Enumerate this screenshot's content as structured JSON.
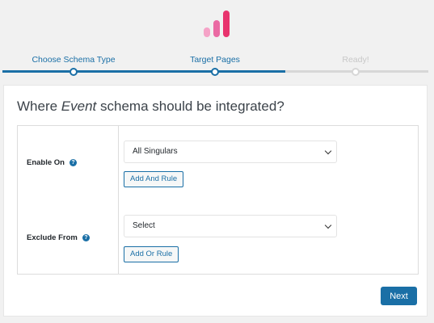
{
  "steps": [
    {
      "label": "Choose Schema Type",
      "state": "complete"
    },
    {
      "label": "Target Pages",
      "state": "current"
    },
    {
      "label": "Ready!",
      "state": "upcoming"
    }
  ],
  "heading": {
    "prefix": "Where ",
    "schema_type": "Event",
    "suffix": " schema should be integrated?"
  },
  "rules": {
    "enable_on": {
      "label": "Enable On",
      "help_icon": "?",
      "selected": "All Singulars",
      "add_button": "Add And Rule"
    },
    "exclude_from": {
      "label": "Exclude From",
      "help_icon": "?",
      "selected": "Select",
      "add_button": "Add Or Rule"
    }
  },
  "next_button": "Next",
  "colors": {
    "accent": "#1a6fa6",
    "logo": [
      "#f5a3c7",
      "#ea6aa3",
      "#e8336d"
    ]
  }
}
